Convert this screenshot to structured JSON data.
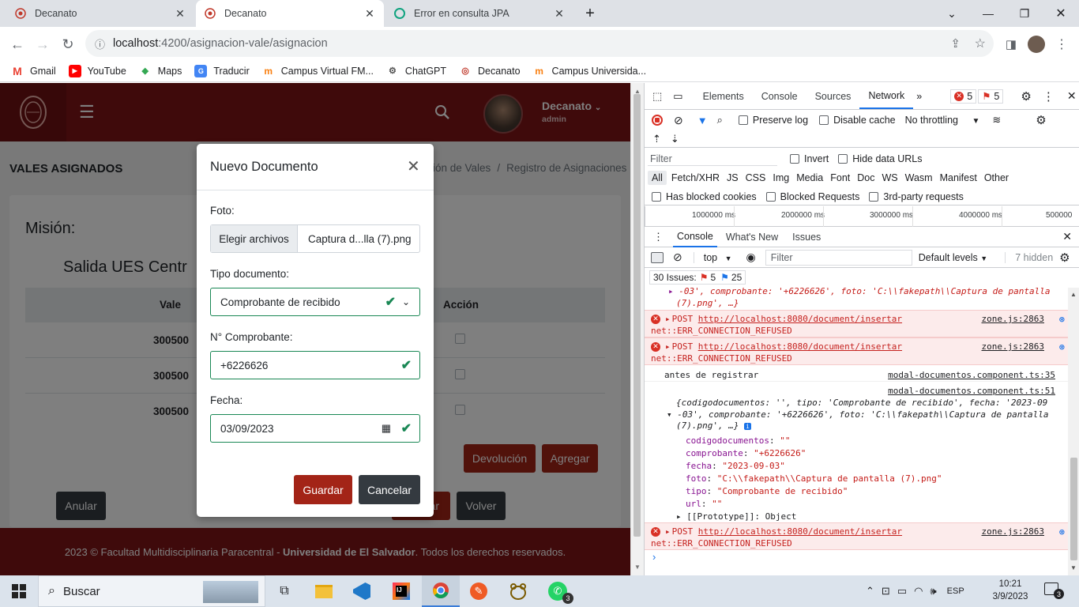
{
  "browser": {
    "tabs": [
      {
        "title": "Decanato",
        "active": false
      },
      {
        "title": "Decanato",
        "active": true
      },
      {
        "title": "Error en consulta JPA",
        "active": false
      }
    ],
    "url_host": "localhost",
    "url_path": ":4200/asignacion-vale/asignacion",
    "bookmarks": [
      "Gmail",
      "YouTube",
      "Maps",
      "Traducir",
      "Campus Virtual FM...",
      "ChatGPT",
      "Decanato",
      "Campus Universida..."
    ]
  },
  "app": {
    "user_name": "Decanato",
    "user_role": "admin",
    "page_title": "VALES ASIGNADOS",
    "breadcrumb": [
      "ión de Vales",
      "/",
      "Registro de Asignaciones"
    ],
    "mision_label": "Misión:",
    "salida_text": "Salida UES Centr",
    "table_headers": [
      "Vale",
      "Acción"
    ],
    "rows": [
      "300500",
      "300500",
      "300500"
    ],
    "buttons": {
      "devolucion": "Devolución",
      "agregar": "Agregar",
      "anular": "Anular",
      "hidden_btn": "ar",
      "volver": "Volver"
    },
    "footer_prefix": "2023 © Facultad Multidisciplinaria Paracentral - ",
    "footer_bold": "Universidad de El Salvador",
    "footer_suffix": ". Todos los derechos reservados."
  },
  "modal": {
    "title": "Nuevo Documento",
    "foto_label": "Foto:",
    "file_button": "Elegir archivos",
    "file_name": "Captura d...lla (7).png",
    "tipo_label": "Tipo documento:",
    "tipo_value": "Comprobante de recibido",
    "comprobante_label": "N° Comprobante:",
    "comprobante_value": "+6226626",
    "fecha_label": "Fecha:",
    "fecha_value": "03/09/2023",
    "guardar": "Guardar",
    "cancelar": "Cancelar"
  },
  "devtools": {
    "tabs": [
      "Elements",
      "Console",
      "Sources",
      "Network"
    ],
    "selected_tab": "Network",
    "error_count": "5",
    "issue_count": "5",
    "preserve_log": "Preserve log",
    "disable_cache": "Disable cache",
    "throttling": "No throttling",
    "filter_placeholder": "Filter",
    "invert": "Invert",
    "hide_data_urls": "Hide data URLs",
    "filter_types": [
      "All",
      "Fetch/XHR",
      "JS",
      "CSS",
      "Img",
      "Media",
      "Font",
      "Doc",
      "WS",
      "Wasm",
      "Manifest",
      "Other"
    ],
    "has_blocked_cookies": "Has blocked cookies",
    "blocked_requests": "Blocked Requests",
    "third_party": "3rd-party requests",
    "timeline": [
      "1000000 ms",
      "2000000 ms",
      "3000000 ms",
      "4000000 ms",
      "500000"
    ],
    "drawer_tabs": [
      "Console",
      "What's New",
      "Issues"
    ],
    "context": "top",
    "console_filter_placeholder": "Filter",
    "default_levels": "Default levels",
    "hidden_count": "7 hidden",
    "issues_label": "30 Issues:",
    "issues_errors": "5",
    "issues_info": "25",
    "log_top_1": "-03', comprobante: '+6226626', foto: 'C:\\\\fakepath\\\\Captura de pantalla",
    "log_top_2": "(7).png', …}",
    "err_post": "POST",
    "err_url": "http://localhost:8080/document/insertar",
    "err_msg": "net::ERR_CONNECTION_REFUSED",
    "err_src": "zone.js:2863",
    "log_antes": "antes de registrar",
    "log_antes_src": "modal-documentos.component.ts:35",
    "log_obj_src": "modal-documentos.component.ts:51",
    "obj_line1": "{codigodocumentos: '', tipo: 'Comprobante de recibido', fecha: '2023-09",
    "obj_line2": "-03', comprobante: '+6226626', foto: 'C:\\\\fakepath\\\\Captura de pantalla",
    "obj_line3": "(7).png', …}",
    "props": [
      {
        "k": "codigodocumentos",
        "v": "\"\""
      },
      {
        "k": "comprobante",
        "v": "\"+6226626\""
      },
      {
        "k": "fecha",
        "v": "\"2023-09-03\""
      },
      {
        "k": "foto",
        "v": "\"C:\\\\fakepath\\\\Captura de pantalla (7).png\""
      },
      {
        "k": "tipo",
        "v": "\"Comprobante de recibido\""
      },
      {
        "k": "url",
        "v": "\"\""
      }
    ],
    "prototype": "[[Prototype]]: Object"
  },
  "taskbar": {
    "search_label": "Buscar",
    "language": "ESP",
    "time": "10:21",
    "date": "3/9/2023",
    "notifications": "3",
    "whatsapp_badge": "3"
  },
  "colors": {
    "brand": "#7e1416",
    "valid": "#198754",
    "button_red": "#a32417",
    "button_dark": "#343a40",
    "devtools_accent": "#1a73e8"
  }
}
